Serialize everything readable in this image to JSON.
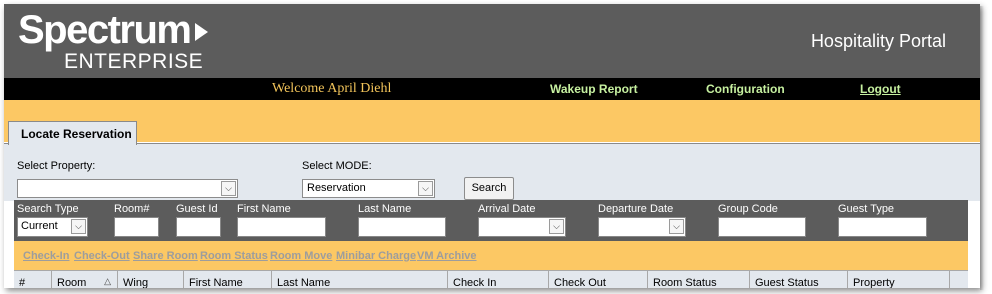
{
  "header": {
    "logo_main": "Spectrum",
    "logo_sub": "ENTERPRISE",
    "portal_title": "Hospitality Portal"
  },
  "nav": {
    "welcome": "Welcome April Diehl",
    "wakeup_report": "Wakeup Report",
    "configuration": "Configuration",
    "logout": "Logout"
  },
  "tab": {
    "label": "Locate Reservation"
  },
  "form": {
    "property_label": "Select Property:",
    "property_value": "",
    "mode_label": "Select MODE:",
    "mode_value": "Reservation",
    "search_button": "Search"
  },
  "filters": {
    "search_type_label": "Search Type",
    "search_type_value": "Current",
    "room_label": "Room#",
    "guest_id_label": "Guest Id",
    "first_name_label": "First Name",
    "last_name_label": "Last Name",
    "arrival_label": "Arrival Date",
    "departure_label": "Departure Date",
    "group_code_label": "Group Code",
    "guest_type_label": "Guest Type"
  },
  "actions": {
    "check_in": "Check-In",
    "check_out": "Check-Out",
    "share_room": "Share Room",
    "room_status": "Room Status",
    "room_move": "Room Move",
    "minibar_charge": "Minibar Charge",
    "vm_archive": "VM Archive"
  },
  "table": {
    "columns": [
      "#",
      "Room",
      "Wing",
      "First Name",
      "Last Name",
      "Check In",
      "Check Out",
      "Room Status",
      "Guest Status",
      "Property"
    ]
  },
  "colors": {
    "header_bg": "#5c5c5c",
    "nav_bg": "#000000",
    "accent_orange": "#fcc864",
    "panel_bg": "#e3e8ee",
    "welcome_text": "#f2c45a",
    "nav_link_text": "#c6f0a0"
  },
  "icons": {
    "logo_arrow": "play-triangle-icon",
    "dropdown": "chevron-down-icon",
    "sort": "sort-ascending-icon"
  }
}
